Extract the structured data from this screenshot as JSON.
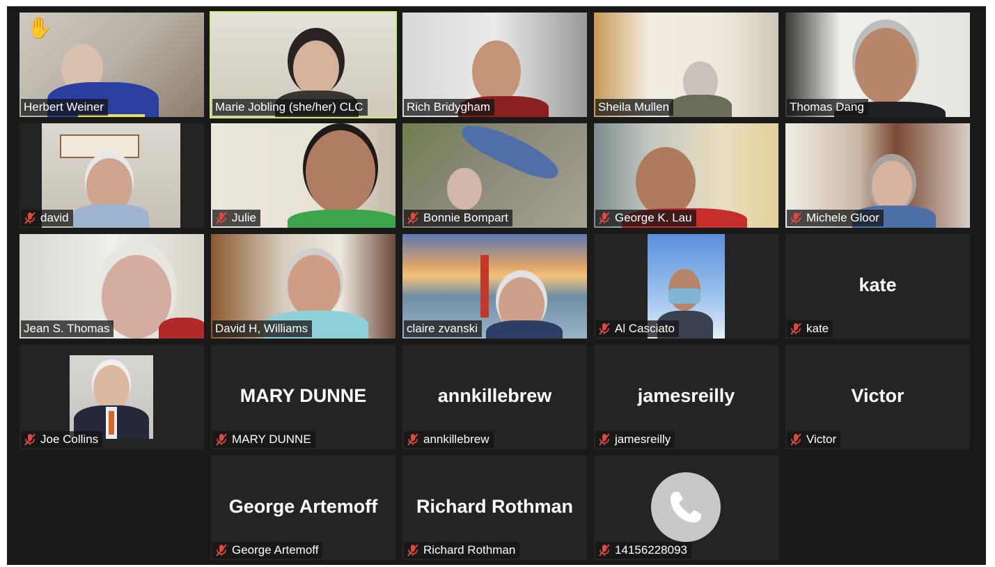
{
  "participants": [
    {
      "name": "Herbert Weiner"
    },
    {
      "name": "Marie Jobling (she/her) CLC"
    },
    {
      "name": "Rich Bridygham"
    },
    {
      "name": "Sheila Mullen"
    },
    {
      "name": "Thomas Dang"
    },
    {
      "name": "david"
    },
    {
      "name": "Julie"
    },
    {
      "name": "Bonnie Bompart"
    },
    {
      "name": "George K. Lau"
    },
    {
      "name": "Michele Gloor"
    },
    {
      "name": "Jean S. Thomas"
    },
    {
      "name": "David H, Williams"
    },
    {
      "name": "claire zvanski"
    },
    {
      "name": "Al Casciato"
    },
    {
      "name": "kate",
      "display": "kate"
    },
    {
      "name": "Joe Collins"
    },
    {
      "name": "MARY DUNNE",
      "display": "MARY DUNNE"
    },
    {
      "name": "annkillebrew",
      "display": "annkillebrew"
    },
    {
      "name": "jamesreilly",
      "display": "jamesreilly"
    },
    {
      "name": "Victor",
      "display": "Victor"
    },
    {
      "name": "George Artemoff",
      "display": "George Artemoff"
    },
    {
      "name": "Richard Rothman",
      "display": "Richard Rothman"
    },
    {
      "name": "14156228093"
    }
  ],
  "colors": {
    "active_speaker": "#c8f06a",
    "mute_icon": "#e0493f",
    "tile_bg": "#242424"
  }
}
